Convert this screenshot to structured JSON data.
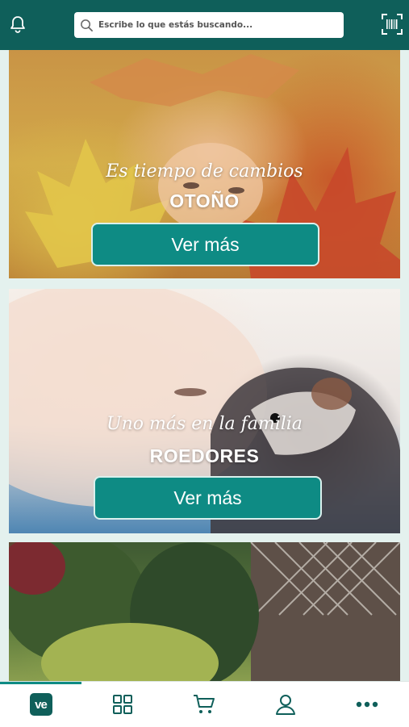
{
  "search": {
    "placeholder": "Escribe lo que estás buscando..."
  },
  "banners": [
    {
      "tagline": "Es tiempo de cambios",
      "title": "OTOÑO",
      "button_label": "Ver más"
    },
    {
      "tagline": "Uno más en la familia",
      "title": "ROEDORES",
      "button_label": "Ver más"
    },
    {
      "tagline": "",
      "title": "",
      "button_label": ""
    }
  ],
  "bottom_nav": {
    "active_index": 0,
    "items": [
      {
        "icon": "ve-logo-icon",
        "logo_text": "ve"
      },
      {
        "icon": "grid-icon"
      },
      {
        "icon": "cart-icon"
      },
      {
        "icon": "user-icon"
      },
      {
        "icon": "more-icon"
      }
    ]
  },
  "colors": {
    "primary": "#0f5f5a",
    "accent": "#0e8b84",
    "background": "#e4f1ee"
  }
}
